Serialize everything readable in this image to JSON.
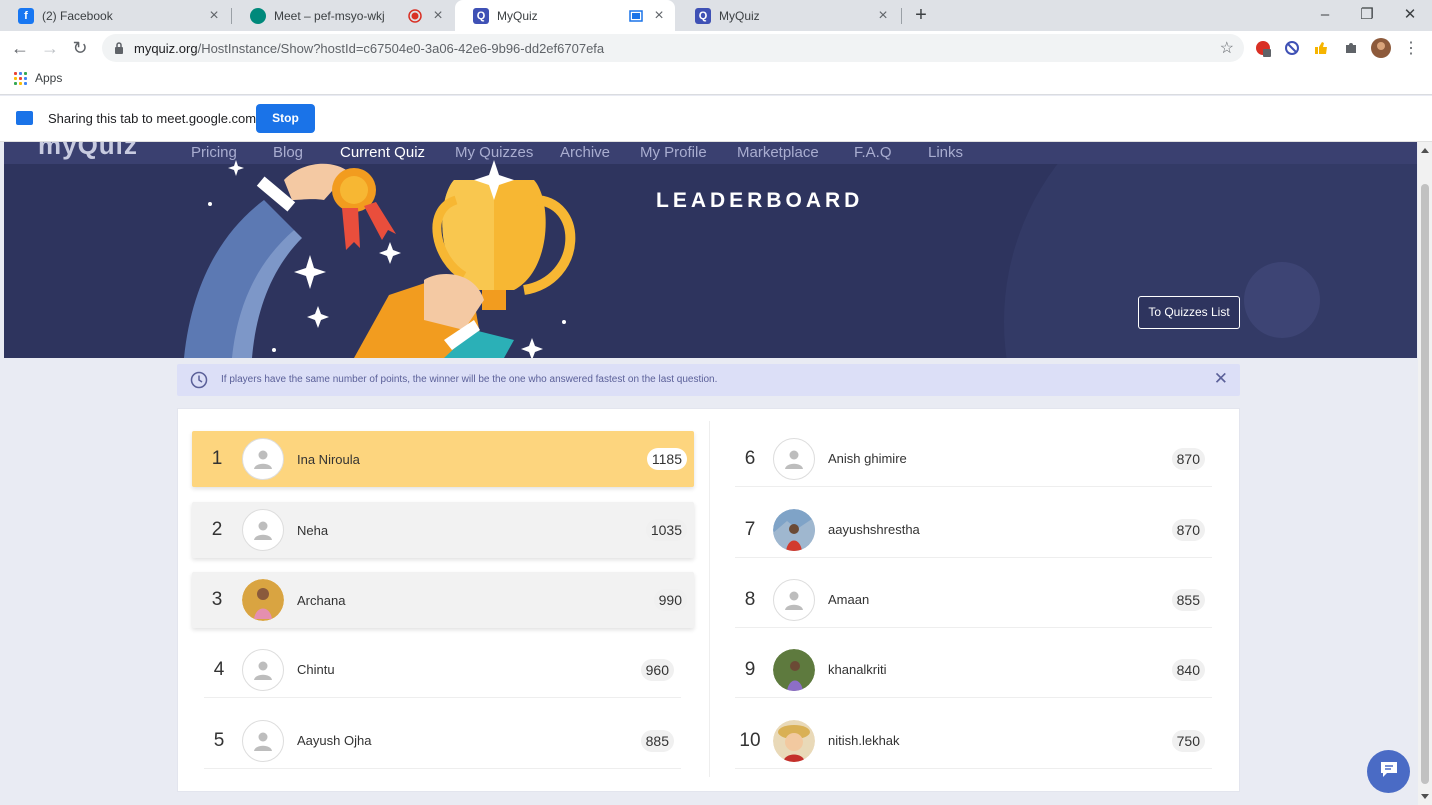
{
  "browser": {
    "tabs": [
      {
        "title": "(2) Facebook",
        "favicon": "facebook-icon"
      },
      {
        "title": "Meet – pef-msyo-wkj",
        "favicon": "google-meet-icon"
      },
      {
        "title": "MyQuiz",
        "favicon": "myquiz-icon"
      },
      {
        "title": "MyQuiz",
        "favicon": "myquiz-icon"
      }
    ],
    "new_tab": "+",
    "window_controls": {
      "minimize": "–",
      "maximize": "❐",
      "close": "✕"
    },
    "url_host": "myquiz.org",
    "url_path": "/HostInstance/Show?hostId=c67504e0-3a06-42e6-9b96-dd2ef6707efa",
    "bookmarks_apps": "Apps"
  },
  "sharing": {
    "text": "Sharing this tab to meet.google.com",
    "stop_label": "Stop"
  },
  "site": {
    "logo_text": "myQuiz",
    "nav": [
      "Pricing",
      "Blog",
      "Current Quiz",
      "My Quizzes",
      "Archive",
      "My Profile",
      "Marketplace",
      "F.A.Q",
      "Links"
    ],
    "active_nav": "Current Quiz",
    "title": "LEADERBOARD",
    "quizzes_button": "To Quizzes List",
    "notice": "If players have the same number of points, the winner will be the one who answered fastest on the last question.",
    "notice_close": "✕"
  },
  "leaderboard": [
    {
      "rank": "1",
      "name": "Ina Niroula",
      "score": "1185",
      "avatar": "default-avatar-icon"
    },
    {
      "rank": "2",
      "name": "Neha",
      "score": "1035",
      "avatar": "default-avatar-icon"
    },
    {
      "rank": "3",
      "name": "Archana",
      "score": "990",
      "avatar": "photo-avatar"
    },
    {
      "rank": "4",
      "name": "Chintu",
      "score": "960",
      "avatar": "default-avatar-icon"
    },
    {
      "rank": "5",
      "name": "Aayush Ojha",
      "score": "885",
      "avatar": "default-avatar-icon"
    },
    {
      "rank": "6",
      "name": "Anish ghimire",
      "score": "870",
      "avatar": "default-avatar-icon"
    },
    {
      "rank": "7",
      "name": "aayushshrestha",
      "score": "870",
      "avatar": "photo-avatar"
    },
    {
      "rank": "8",
      "name": "Amaan",
      "score": "855",
      "avatar": "default-avatar-icon"
    },
    {
      "rank": "9",
      "name": "khanalkriti",
      "score": "840",
      "avatar": "photo-avatar"
    },
    {
      "rank": "10",
      "name": "nitish.lekhak",
      "score": "750",
      "avatar": "photo-avatar"
    }
  ],
  "colors": {
    "hero_bg": "#2e345e",
    "first_place": "#fdd57e",
    "notice_bg": "#dcdff7",
    "chat_button": "#4a6bc5",
    "share_blue": "#1a73e8"
  }
}
